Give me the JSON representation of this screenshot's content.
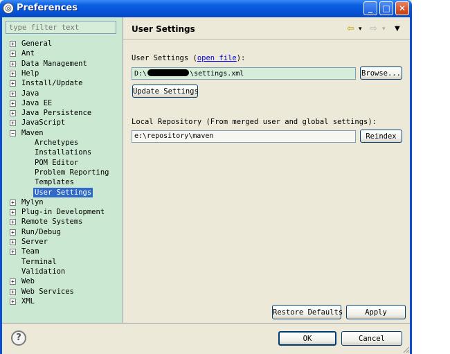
{
  "window": {
    "title": "Preferences",
    "buttons": {
      "minimize": "_",
      "maximize": "□",
      "close": "✕"
    }
  },
  "sidebar": {
    "filter_placeholder": "type filter text",
    "expand_glyph": "+",
    "collapse_glyph": "−",
    "items": [
      {
        "label": "General",
        "expanded": false
      },
      {
        "label": "Ant",
        "expanded": false
      },
      {
        "label": "Data Management",
        "expanded": false
      },
      {
        "label": "Help",
        "expanded": false
      },
      {
        "label": "Install/Update",
        "expanded": false
      },
      {
        "label": "Java",
        "expanded": false
      },
      {
        "label": "Java EE",
        "expanded": false
      },
      {
        "label": "Java Persistence",
        "expanded": false
      },
      {
        "label": "JavaScript",
        "expanded": false
      },
      {
        "label": "Maven",
        "expanded": true
      },
      {
        "label": "Mylyn",
        "expanded": false
      },
      {
        "label": "Plug-in Development",
        "expanded": false
      },
      {
        "label": "Remote Systems",
        "expanded": false
      },
      {
        "label": "Run/Debug",
        "expanded": false
      },
      {
        "label": "Server",
        "expanded": false
      },
      {
        "label": "Team",
        "expanded": false
      },
      {
        "label": "Terminal",
        "expanded": null
      },
      {
        "label": "Validation",
        "expanded": null
      },
      {
        "label": "Web",
        "expanded": false
      },
      {
        "label": "Web Services",
        "expanded": false
      },
      {
        "label": "XML",
        "expanded": false
      }
    ],
    "maven_children": [
      "Archetypes",
      "Installations",
      "POM Editor",
      "Problem Reporting",
      "Templates",
      "User Settings"
    ],
    "selected": "User Settings"
  },
  "main": {
    "title": "User Settings",
    "nav": {
      "back_icon": "⇦",
      "forward_icon": "⇨",
      "dropdown_icon": "▾",
      "menu_icon": "▼"
    },
    "user_settings_label": "User Settings (",
    "open_file_link": "open file",
    "user_settings_label_end": "):",
    "settings_path_prefix": "D:\\",
    "settings_path_suffix": "\\settings.xml",
    "browse_button": "Browse...",
    "update_button": "Update Settings",
    "local_repo_label": "Local Repository (From merged user and global settings):",
    "local_repo_value": "e:\\repository\\maven",
    "reindex_button": "Reindex",
    "restore_defaults_button": "Restore Defaults",
    "apply_button": "Apply"
  },
  "footer": {
    "help_icon": "?",
    "ok_button": "OK",
    "cancel_button": "Cancel"
  }
}
